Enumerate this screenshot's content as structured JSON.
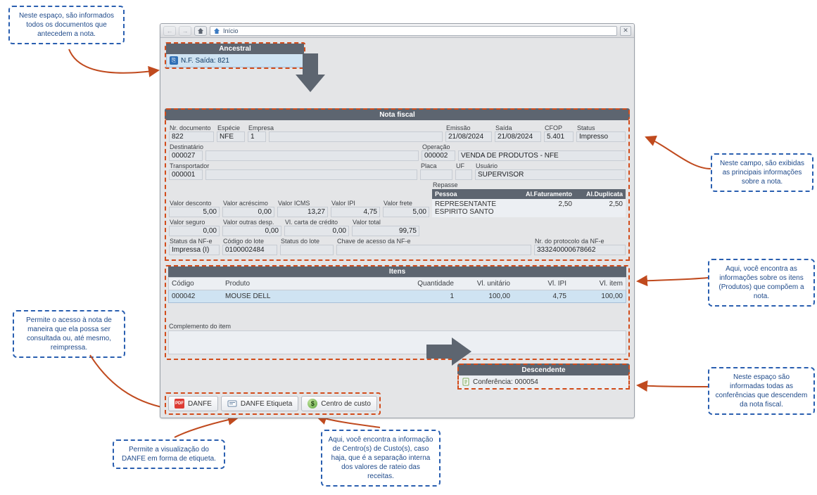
{
  "callouts": {
    "topLeft": "Neste espaço, são informados todos os documentos que antecedem a nota.",
    "right1": "Neste campo, são exibidas as principais informações sobre a nota.",
    "right2": "Aqui, você encontra as informações sobre os itens (Produtos) que compõem a nota.",
    "right3": "Neste espaço são informadas todas as conferências que descendem da nota fiscal.",
    "left1": "Permite o acesso à nota de maneira que ela possa ser consultada ou, até mesmo, reimpressa.",
    "bottom1": "Permite a visualização do DANFE em forma de etiqueta.",
    "bottom2": "Aqui, você encontra a informação de Centro(s) de Custo(s), caso haja, que é a separação interna dos valores de rateio das receitas."
  },
  "toolbar": {
    "title": "Início"
  },
  "ancestral": {
    "header": "Ancestral",
    "item": "N.F. Saída: 821"
  },
  "nota": {
    "header": "Nota fiscal",
    "labels": {
      "nrDoc": "Nr. documento",
      "especie": "Espécie",
      "empresa": "Empresa",
      "emissao": "Emissão",
      "saida": "Saída",
      "cfop": "CFOP",
      "status": "Status",
      "destinatario": "Destinatário",
      "operacao": "Operação",
      "transportador": "Transportador",
      "placa": "Placa",
      "uf": "UF",
      "usuario": "Usuário",
      "vDesc": "Valor desconto",
      "vAcr": "Valor acréscimo",
      "vIcms": "Valor ICMS",
      "vIpi": "Valor IPI",
      "vFrete": "Valor frete",
      "repasse": "Repasse",
      "rpPessoa": "Pessoa",
      "rpFat": "Al.Faturamento",
      "rpDup": "Al.Duplicata",
      "vSeg": "Valor seguro",
      "vOut": "Valor outras desp.",
      "vCart": "Vl. carta de crédito",
      "vTot": "Valor total",
      "stNfe": "Status da NF-e",
      "codLote": "Código do lote",
      "stLote": "Status do lote",
      "chave": "Chave de acesso da NF-e",
      "prot": "Nr. do protocolo da NF-e"
    },
    "v": {
      "nrDoc": "822",
      "especie": "NFE",
      "empresa": "1",
      "empresaNome": "",
      "emissao": "21/08/2024",
      "saida": "21/08/2024",
      "cfop": "5.401",
      "status": "Impresso",
      "destCod": "000027",
      "destNome": "",
      "opCod": "000002",
      "opNome": "VENDA DE PRODUTOS - NFE",
      "transCod": "000001",
      "transNome": "",
      "placa": "",
      "uf": "",
      "usuario": "SUPERVISOR",
      "vDesc": "5,00",
      "vAcr": "0,00",
      "vIcms": "13,27",
      "vIpi": "4,75",
      "vFrete": "5,00",
      "rpPessoa": "REPRESENTANTE ESPIRITO SANTO",
      "rpFat": "2,50",
      "rpDup": "2,50",
      "vSeg": "0,00",
      "vOut": "0,00",
      "vCart": "0,00",
      "vTot": "99,75",
      "stNfe": "Impressa (I)",
      "codLote": "0100002484",
      "stLote": "",
      "chave": "",
      "prot": "333240000678662"
    }
  },
  "itens": {
    "header": "Itens",
    "cols": {
      "cod": "Código",
      "prod": "Produto",
      "q": "Quantidade",
      "vu": "Vl. unitário",
      "ipi": "Vl. IPI",
      "vi": "Vl. item"
    },
    "rows": [
      {
        "cod": "000042",
        "prod": "MOUSE DELL",
        "q": "1",
        "vu": "100,00",
        "ipi": "4,75",
        "vi": "100,00"
      }
    ],
    "complementoLabel": "Complemento do item"
  },
  "descendente": {
    "header": "Descendente",
    "item": "Conferência: 000054"
  },
  "buttons": {
    "danfe": "DANFE",
    "etiqueta": "DANFE Etiqueta",
    "centro": "Centro de custo"
  }
}
